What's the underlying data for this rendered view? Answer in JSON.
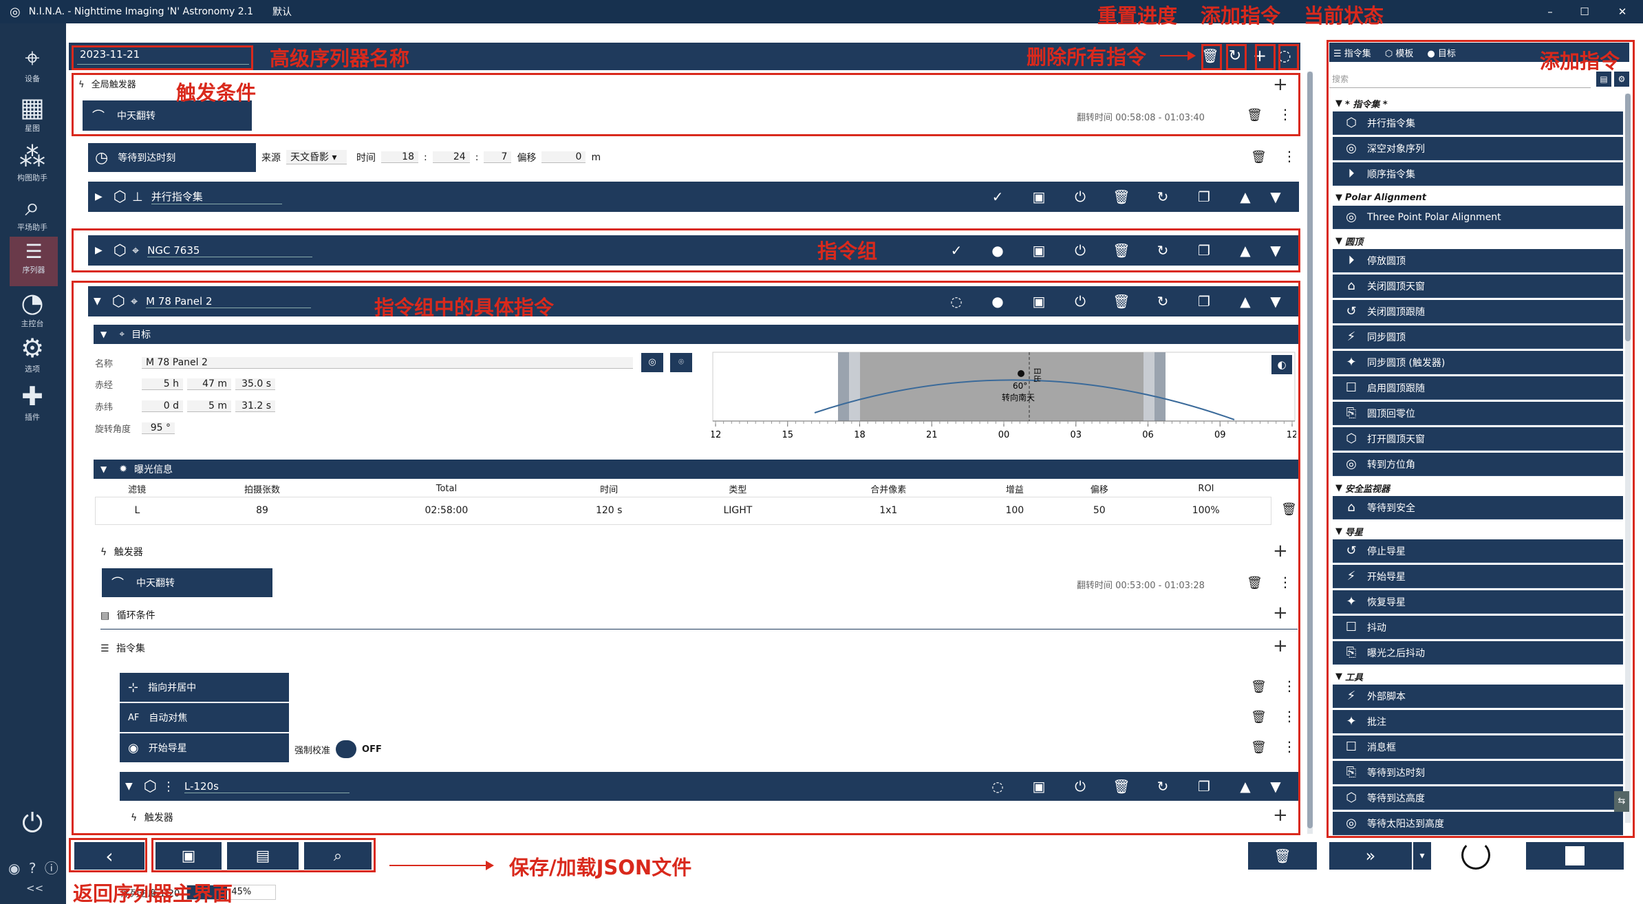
{
  "window": {
    "title": "N.I.N.A. - Nighttime Imaging 'N' Astronomy 2.1",
    "profile": "默认",
    "min": "–",
    "max": "☐",
    "close": "✕"
  },
  "sidebar": {
    "items": [
      {
        "label": "设备",
        "icon": "telescope-icon"
      },
      {
        "label": "星图",
        "icon": "skymap-icon"
      },
      {
        "label": "构图助手",
        "icon": "framing-icon"
      },
      {
        "label": "平场助手",
        "icon": "flat-wizard-icon"
      },
      {
        "label": "序列器",
        "icon": "sequencer-icon"
      },
      {
        "label": "主控台",
        "icon": "imaging-icon"
      },
      {
        "label": "选项",
        "icon": "gears-icon"
      },
      {
        "label": "插件",
        "icon": "puzzle-icon"
      }
    ],
    "collapse": "<<"
  },
  "sequence_name": "2023-11-21",
  "global_triggers": {
    "label": "全局触发器",
    "item": "中天翻转",
    "info": "翻转时间 00:58:08 - 01:03:40"
  },
  "wait_time": {
    "label": "等待到达时刻",
    "source_label": "来源",
    "source_value": "天文昏影",
    "time_label": "时间",
    "h": "18",
    "m": "24",
    "s": "7",
    "offset_label": "偏移",
    "offset_value": "0",
    "offset_unit": "m"
  },
  "parallel_set": {
    "label": "并行指令集"
  },
  "ngc_group": {
    "label": "NGC 7635"
  },
  "m78_group": {
    "label": "M 78 Panel 2",
    "target_header": "目标",
    "name_label": "名称",
    "name_value": "M 78 Panel 2",
    "ra_label": "赤经",
    "ra": {
      "h": "5",
      "m": "47",
      "s": "35.0"
    },
    "dec_label": "赤纬",
    "dec": {
      "d": "0",
      "m": "5",
      "s": "31.2"
    },
    "rot_label": "旋转角度",
    "rot_value": "95",
    "chart": {
      "ticks": [
        "12",
        "15",
        "18",
        "21",
        "00",
        "03",
        "06",
        "09",
        "12"
      ],
      "marker_label": "60°",
      "meridian_label": "转向南天",
      "dark_label": "日出"
    },
    "exposure_header": "曝光信息",
    "exposure_cols": [
      "滤镜",
      "拍摄张数",
      "Total",
      "时间",
      "类型",
      "合并像素",
      "增益",
      "偏移",
      "ROI"
    ],
    "exposure_row": [
      "L",
      "89",
      "02:58:00",
      "120 s",
      "LIGHT",
      "1x1",
      "100",
      "50",
      "100%"
    ],
    "triggers_label": "触发器",
    "trigger_item": "中天翻转",
    "trigger_info": "翻转时间 00:53:00 - 01:03:28",
    "loop_label": "循环条件",
    "set_label": "指令集",
    "instructions": [
      "指向并居中",
      "自动对焦",
      "开始导星"
    ],
    "force_calib_label": "强制校准",
    "force_calib_value": "OFF",
    "sub_group": "L-120s",
    "sub_triggers": "触发器"
  },
  "right_panel": {
    "tabs": [
      "指令集",
      "模板",
      "目标"
    ],
    "search_placeholder": "搜索",
    "categories": [
      {
        "name": "* 指令集 *",
        "items": [
          "并行指令集",
          "深空对象序列",
          "顺序指令集"
        ]
      },
      {
        "name": "Polar Alignment",
        "items": [
          "Three Point Polar Alignment"
        ]
      },
      {
        "name": "圆顶",
        "items": [
          "停放圆顶",
          "关闭圆顶天窗",
          "关闭圆顶跟随",
          "同步圆顶",
          "同步圆顶 (触发器)",
          "启用圆顶跟随",
          "圆顶回零位",
          "打开圆顶天窗",
          "转到方位角"
        ]
      },
      {
        "name": "安全监视器",
        "items": [
          "等待到安全"
        ]
      },
      {
        "name": "导星",
        "items": [
          "停止导星",
          "开始导星",
          "恢复导星",
          "抖动",
          "曝光之后抖动"
        ]
      },
      {
        "name": "工具",
        "items": [
          "外部脚本",
          "批注",
          "消息框",
          "等待到达时刻",
          "等待到达高度",
          "等待太阳达到高度"
        ]
      }
    ]
  },
  "status": {
    "progress_label": "序列进度 1/20",
    "progress_value": "45%",
    "progress_fraction": 0.45
  },
  "annotations": {
    "reset_progress": "重置进度",
    "add_instruction": "添加指令",
    "current_state": "当前状态",
    "seq_name": "高级序列器名称",
    "delete_all": "删除所有指令",
    "add_instruction_right": "添加指令",
    "trigger_condition": "触发条件",
    "instruction_group": "指令组",
    "specific_instructions": "指令组中的具体指令",
    "save_load": "保存/加载JSON文件",
    "back": "返回序列器主界面"
  },
  "colors": {
    "sidebar_bg": "#1c3450",
    "bar_bg": "#1f3a5c",
    "annotation": "#d9291c",
    "active_side": "#6a3a4a"
  }
}
